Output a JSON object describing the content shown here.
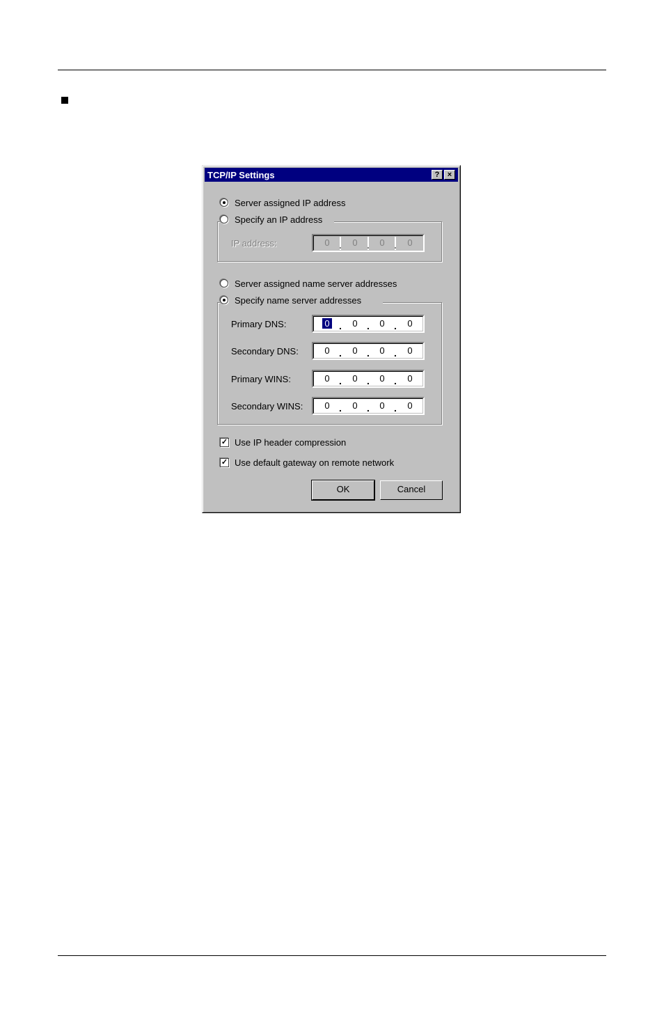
{
  "dialog": {
    "title": "TCP/IP Settings",
    "help_button": "?",
    "close_button": "×"
  },
  "ip_section": {
    "server_assigned_label": "Server assigned IP address",
    "specify_label": "Specify an IP address",
    "selected": "server_assigned",
    "ip_address_label": "IP address:",
    "ip_address": [
      "0",
      "0",
      "0",
      "0"
    ]
  },
  "dns_section": {
    "server_assigned_label": "Server assigned name server addresses",
    "specify_label": "Specify name server addresses",
    "selected": "specify",
    "fields": [
      {
        "label": "Primary DNS:",
        "octets": [
          "0",
          "0",
          "0",
          "0"
        ]
      },
      {
        "label": "Secondary DNS:",
        "octets": [
          "0",
          "0",
          "0",
          "0"
        ]
      },
      {
        "label": "Primary WINS:",
        "octets": [
          "0",
          "0",
          "0",
          "0"
        ]
      },
      {
        "label": "Secondary WINS:",
        "octets": [
          "0",
          "0",
          "0",
          "0"
        ]
      }
    ]
  },
  "options": {
    "ip_header_compression_label": "Use IP header compression",
    "ip_header_compression_checked": true,
    "default_gateway_label": "Use default gateway on remote network",
    "default_gateway_checked": true
  },
  "buttons": {
    "ok": "OK",
    "cancel": "Cancel"
  },
  "colors": {
    "face": "#c0c0c0",
    "titlebar": "#000080"
  }
}
